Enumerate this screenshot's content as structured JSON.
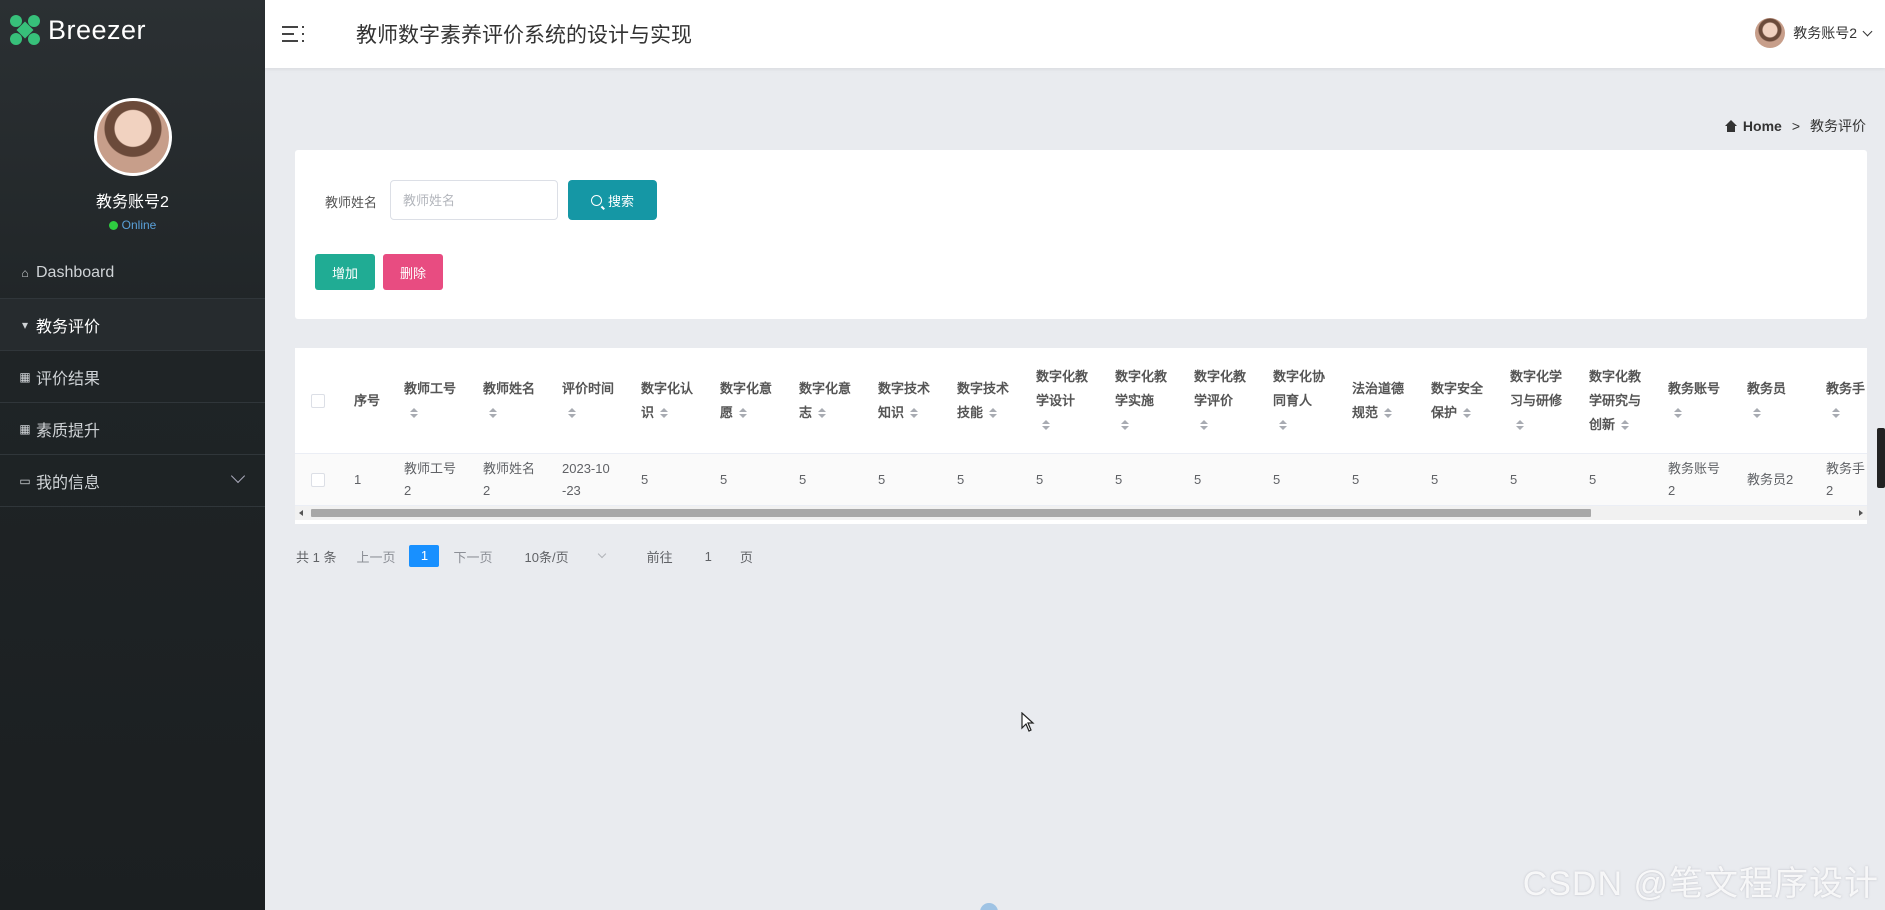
{
  "brand": {
    "name": "Breezer"
  },
  "sidebar": {
    "profile": {
      "name": "教务账号2",
      "status": "Online"
    },
    "items": [
      {
        "label": "Dashboard",
        "icon": "home-icon"
      },
      {
        "label": "教务评价",
        "icon": "badge-icon",
        "active": true
      },
      {
        "label": "评价结果",
        "icon": "grid-icon"
      },
      {
        "label": "素质提升",
        "icon": "grid-icon"
      },
      {
        "label": "我的信息",
        "icon": "card-icon",
        "expandable": true
      }
    ]
  },
  "header": {
    "title": "教师数字素养评价系统的设计与实现",
    "user": "教务账号2"
  },
  "breadcrumb": {
    "home": "Home",
    "separator": ">",
    "current": "教务评价"
  },
  "search": {
    "label": "教师姓名",
    "placeholder": "教师姓名",
    "button": "搜索"
  },
  "actions": {
    "add": "增加",
    "delete": "删除"
  },
  "table": {
    "columns": [
      {
        "l1": "序号",
        "l2": ""
      },
      {
        "l1": "教师工号",
        "l2": ""
      },
      {
        "l1": "教师姓名",
        "l2": ""
      },
      {
        "l1": "评价时间",
        "l2": ""
      },
      {
        "l1": "数字化认",
        "l2": "识"
      },
      {
        "l1": "数字化意",
        "l2": "愿"
      },
      {
        "l1": "数字化意",
        "l2": "志"
      },
      {
        "l1": "数字技术",
        "l2": "知识"
      },
      {
        "l1": "数字技术",
        "l2": "技能"
      },
      {
        "l1": "数字化教",
        "l2": "学设计"
      },
      {
        "l1": "数字化教",
        "l2": "学实施"
      },
      {
        "l1": "数字化教",
        "l2": "学评价"
      },
      {
        "l1": "数字化协",
        "l2": "同育人"
      },
      {
        "l1": "法治道德",
        "l2": "规范"
      },
      {
        "l1": "数字安全",
        "l2": "保护"
      },
      {
        "l1": "数字化学",
        "l2": "习与研修"
      },
      {
        "l1": "数字化教",
        "l2": "学研究与",
        "l3": "创新"
      },
      {
        "l1": "教务账号",
        "l2": ""
      },
      {
        "l1": "教务员",
        "l2": ""
      },
      {
        "l1": "教务手",
        "l2": ""
      }
    ],
    "rows": [
      [
        "1",
        "教师工号\n2",
        "教师姓名\n2",
        "2023-10\n-23",
        "5",
        "5",
        "5",
        "5",
        "5",
        "5",
        "5",
        "5",
        "5",
        "5",
        "5",
        "5",
        "5",
        "教务账号\n2",
        "教务员2",
        "教务手\n2"
      ]
    ]
  },
  "pagination": {
    "total": "共 1 条",
    "prev": "上一页",
    "page": "1",
    "next": "下一页",
    "size": "10条/页",
    "goto": "前往",
    "goto_value": "1",
    "goto_suffix": "页"
  },
  "watermark": "CSDN @笔文程序设计",
  "colors": {
    "accent": "#1597a5",
    "add": "#20ac94",
    "delete": "#e84c81",
    "page_active": "#1890ff",
    "sidebar": "#1f2426"
  }
}
